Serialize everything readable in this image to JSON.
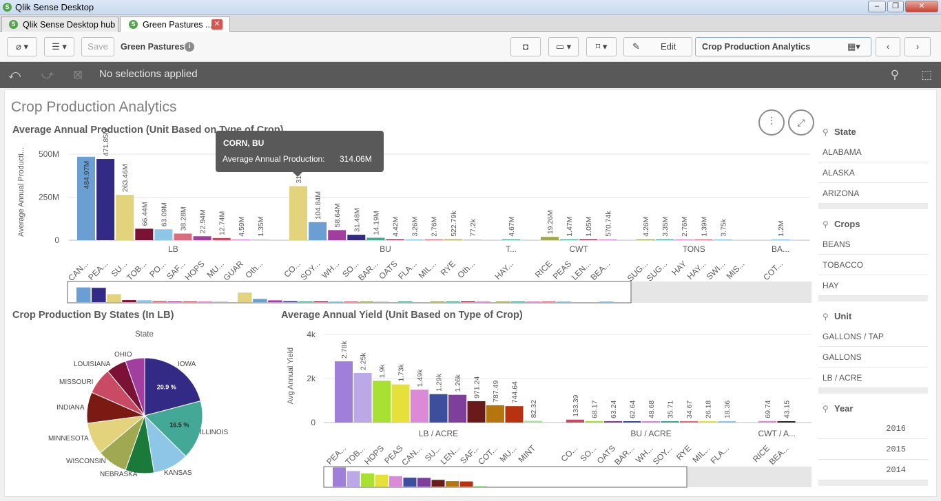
{
  "window": {
    "title": "Qlik Sense Desktop"
  },
  "tabs": [
    {
      "label": "Qlik Sense Desktop hub"
    },
    {
      "label": "Green Pastures ..."
    }
  ],
  "toolbar": {
    "save": "Save",
    "app_name": "Green Pastures",
    "edit": "Edit",
    "sheet_name": "Crop Production Analytics"
  },
  "selections": {
    "text": "No selections applied"
  },
  "sheet": {
    "title": "Crop Production Analytics"
  },
  "colors": {
    "selbar": "#595959",
    "accent": "#52a54a"
  },
  "tooltip": {
    "title": "CORN, BU",
    "label": "Average Annual Production:",
    "value": "314.06M"
  },
  "chart_data": [
    {
      "type": "bar",
      "title": "Average Annual Production (Unit Based on Type of Crop)",
      "ylabel": "Average Annual Producti...",
      "yticks": [
        "500M",
        "250M",
        "0"
      ],
      "ylim": [
        0,
        560
      ],
      "groups": [
        {
          "label": "LB",
          "bars": [
            {
              "cat": "CAN...",
              "value": 484.97,
              "text": "484.97M",
              "color": "#6a9fd4"
            },
            {
              "cat": "PEA...",
              "value": 471.85,
              "text": "471.85M",
              "color": "#332a86"
            },
            {
              "cat": "SU...",
              "value": 263.46,
              "text": "263.46M",
              "color": "#e2d37c"
            },
            {
              "cat": "TOB...",
              "value": 66.44,
              "text": "66.44M",
              "color": "#7b1236"
            },
            {
              "cat": "PO...",
              "value": 63.09,
              "text": "63.09M",
              "color": "#8ec6e8"
            },
            {
              "cat": "SAF...",
              "value": 38.28,
              "text": "38.28M",
              "color": "#db6b7f"
            },
            {
              "cat": "HOPS",
              "value": 22.94,
              "text": "22.94M",
              "color": "#a33ea1"
            },
            {
              "cat": "MU...",
              "value": 12.74,
              "text": "12.74M",
              "color": "#c94b63"
            },
            {
              "cat": "GUAR",
              "value": 4.59,
              "text": "4.59M",
              "color": "#db8ad6"
            },
            {
              "cat": "Oth...",
              "value": 1.35,
              "text": "1.35M",
              "color": "#cccccc"
            }
          ]
        },
        {
          "label": "BU",
          "bars": [
            {
              "cat": "CO...",
              "value": 314.06,
              "text": "314.06M",
              "color": "#e2d37c"
            },
            {
              "cat": "SOY...",
              "value": 104.84,
              "text": "104.84M",
              "color": "#6a9fd4"
            },
            {
              "cat": "WH...",
              "value": 58.64,
              "text": "58.64M",
              "color": "#a33ea1"
            },
            {
              "cat": "SO...",
              "value": 31.48,
              "text": "31.48M",
              "color": "#332a86"
            },
            {
              "cat": "BAR...",
              "value": 14.19,
              "text": "14.19M",
              "color": "#43a896"
            },
            {
              "cat": "OATS",
              "value": 4.42,
              "text": "4.42M",
              "color": "#7b1236"
            },
            {
              "cat": "FLA...",
              "value": 3.26,
              "text": "3.26M",
              "color": "#8ec6e8"
            },
            {
              "cat": "MIL...",
              "value": 2.76,
              "text": "2.76M",
              "color": "#db6b7f"
            },
            {
              "cat": "RYE",
              "value": 0.52279,
              "text": "522.79k",
              "color": "#a0a852"
            },
            {
              "cat": "Oth...",
              "value": 0.0772,
              "text": "77.2k",
              "color": "#cccccc"
            }
          ]
        },
        {
          "label": "T...",
          "bars": [
            {
              "cat": "HAY...",
              "value": 4.67,
              "text": "4.67M",
              "color": "#43a896"
            }
          ]
        },
        {
          "label": "CWT",
          "bars": [
            {
              "cat": "RICE",
              "value": 19.26,
              "text": "19.26M",
              "color": "#a0a852"
            },
            {
              "cat": "PEAS",
              "value": 1.47,
              "text": "1.47M",
              "color": "#43a896"
            },
            {
              "cat": "LEN...",
              "value": 1.05,
              "text": "1.05M",
              "color": "#7b1236"
            },
            {
              "cat": "BEA...",
              "value": 0.57074,
              "text": "570.74k",
              "color": "#db8ad6"
            }
          ]
        },
        {
          "label": "TONS",
          "bars": [
            {
              "cat": "SUG...",
              "value": 4.26,
              "text": "4.26M",
              "color": "#a0a852"
            },
            {
              "cat": "SUG...",
              "value": 3.35,
              "text": "3.35M",
              "color": "#43a896"
            },
            {
              "cat": "HAY",
              "value": 2.76,
              "text": "2.76M",
              "color": "#db8ad6"
            },
            {
              "cat": "HAY...",
              "value": 1.39,
              "text": "1.39M",
              "color": "#db6b7f"
            },
            {
              "cat": "SWI...",
              "value": 0.00375,
              "text": "3.75k",
              "color": "#8ec6e8"
            },
            {
              "cat": "MIS...",
              "value": 0,
              "text": "",
              "color": "#cccccc"
            }
          ]
        },
        {
          "label": "BA...",
          "bars": [
            {
              "cat": "COT...",
              "value": 1.2,
              "text": "1.2M",
              "color": "#8ec6e8"
            }
          ]
        }
      ]
    },
    {
      "type": "pie",
      "title": "Crop Production By States (In LB)",
      "legend_title": "State",
      "slices": [
        {
          "label": "IOWA",
          "value": 20.9,
          "text": "20.9 %",
          "color": "#332a86"
        },
        {
          "label": "ILLINOIS",
          "value": 16.5,
          "text": "16.5 %",
          "color": "#43a896"
        },
        {
          "label": "KANSAS",
          "value": 10.0,
          "text": "",
          "color": "#8ec6e8"
        },
        {
          "label": "NEBRASKA",
          "value": 8.0,
          "text": "",
          "color": "#1a7a3a"
        },
        {
          "label": "WISCONSIN",
          "value": 8.5,
          "text": "",
          "color": "#a0a852"
        },
        {
          "label": "MINNESOTA",
          "value": 9.0,
          "text": "",
          "color": "#e2d37c"
        },
        {
          "label": "INDIANA",
          "value": 8.7,
          "text": "",
          "color": "#7b1a12"
        },
        {
          "label": "MISSOURI",
          "value": 7.4,
          "text": "",
          "color": "#c94b63"
        },
        {
          "label": "LOUISIANA",
          "value": 5.6,
          "text": "",
          "color": "#7b1236"
        },
        {
          "label": "OHIO",
          "value": 5.4,
          "text": "",
          "color": "#a33ea1"
        }
      ]
    },
    {
      "type": "bar",
      "title": "Average Annual Yield (Unit Based on Type of Crop)",
      "ylabel": "Avg Annual Yield",
      "yticks": [
        "4k",
        "2k",
        "0"
      ],
      "ylim": [
        0,
        4000
      ],
      "groups": [
        {
          "label": "LB / ACRE",
          "bars": [
            {
              "cat": "PEA...",
              "value": 2780,
              "text": "2.78k",
              "color": "#a07fdb"
            },
            {
              "cat": "TOB...",
              "value": 2250,
              "text": "2.25k",
              "color": "#bba8e6"
            },
            {
              "cat": "HOPS",
              "value": 1900,
              "text": "1.9k",
              "color": "#a8e033"
            },
            {
              "cat": "PEAS",
              "value": 1730,
              "text": "1.73k",
              "color": "#e6e03a"
            },
            {
              "cat": "CAN...",
              "value": 1490,
              "text": "1.49k",
              "color": "#db8ad6"
            },
            {
              "cat": "SU...",
              "value": 1290,
              "text": "1.29k",
              "color": "#3d4e9c"
            },
            {
              "cat": "LEN...",
              "value": 1260,
              "text": "1.26k",
              "color": "#7e3e9c"
            },
            {
              "cat": "SAF...",
              "value": 971.24,
              "text": "971.24",
              "color": "#6b1a1a"
            },
            {
              "cat": "COT...",
              "value": 787.49,
              "text": "787.49",
              "color": "#b5760e"
            },
            {
              "cat": "MU...",
              "value": 744.64,
              "text": "744.64",
              "color": "#b83210"
            },
            {
              "cat": "MINT",
              "value": 82.32,
              "text": "82.32",
              "color": "#a8e6a0"
            }
          ]
        },
        {
          "label": "BU / ACRE",
          "bars": [
            {
              "cat": "CO...",
              "value": 133.39,
              "text": "133.39",
              "color": "#c94b63"
            },
            {
              "cat": "SO...",
              "value": 68.17,
              "text": "68.17",
              "color": "#a8e033"
            },
            {
              "cat": "OATS",
              "value": 63.24,
              "text": "63.24",
              "color": "#7e3e9c"
            },
            {
              "cat": "BAR...",
              "value": 62.64,
              "text": "62.64",
              "color": "#3d4e9c"
            },
            {
              "cat": "WH...",
              "value": 48.68,
              "text": "48.68",
              "color": "#db8ad6"
            },
            {
              "cat": "SOY...",
              "value": 35.71,
              "text": "35.71",
              "color": "#43a896"
            },
            {
              "cat": "RYE",
              "value": 34.67,
              "text": "34.67",
              "color": "#db6b7f"
            },
            {
              "cat": "MIL...",
              "value": 26.18,
              "text": "26.18",
              "color": "#e6e03a"
            },
            {
              "cat": "FLA...",
              "value": 18.36,
              "text": "18.36",
              "color": "#8ec6e8"
            }
          ]
        },
        {
          "label": "CWT / A...",
          "bars": [
            {
              "cat": "RICE",
              "value": 69.74,
              "text": "69.74",
              "color": "#db8ad6"
            },
            {
              "cat": "BEA...",
              "value": 43.15,
              "text": "43.15",
              "color": "#332a2a"
            }
          ]
        }
      ]
    }
  ],
  "filters": [
    {
      "title": "State",
      "items": [
        "ALABAMA",
        "ALASKA",
        "ARIZONA"
      ],
      "align": "left"
    },
    {
      "title": "Crops",
      "items": [
        "BEANS",
        "TOBACCO",
        "HAY"
      ],
      "align": "left"
    },
    {
      "title": "Unit",
      "items": [
        "GALLONS / TAP",
        "GALLONS",
        "LB / ACRE"
      ],
      "align": "left"
    },
    {
      "title": "Year",
      "items": [
        "2016",
        "2015",
        "2014"
      ],
      "align": "right"
    }
  ]
}
